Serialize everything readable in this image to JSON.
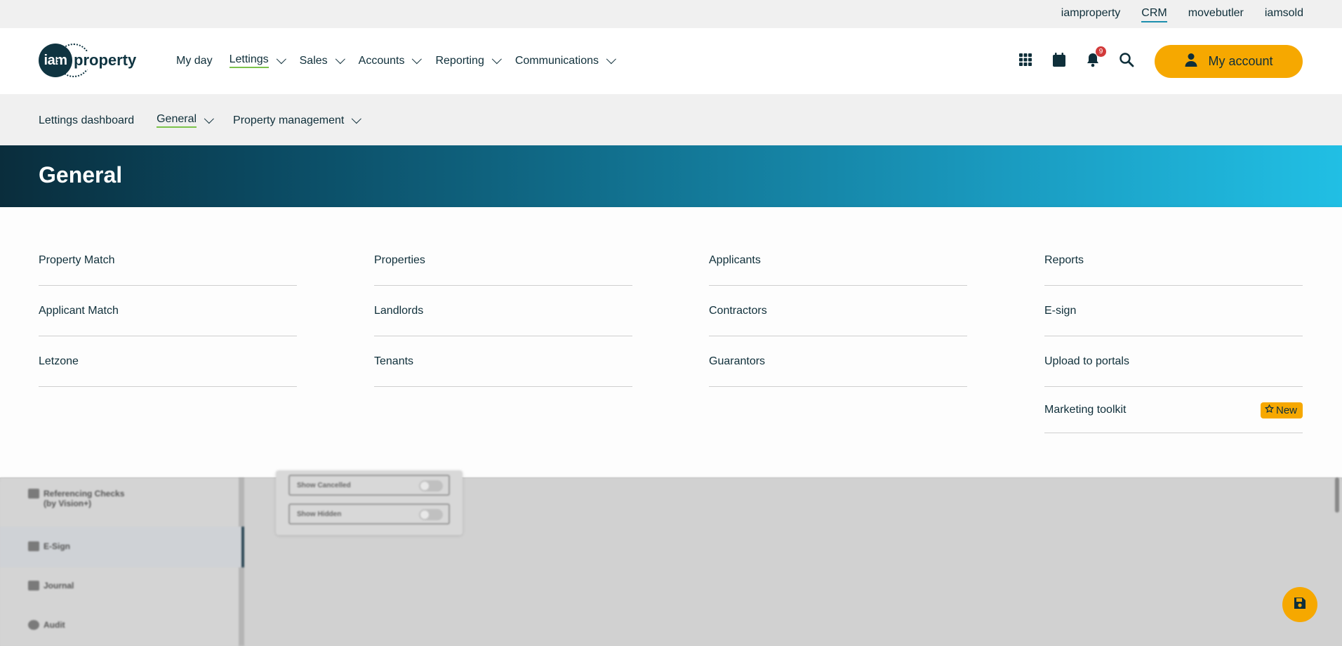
{
  "topbar": {
    "links": [
      "iamproperty",
      "CRM",
      "movebutler",
      "iamsold"
    ],
    "active": "CRM"
  },
  "header": {
    "logo_text": "iam",
    "logo_word": "property",
    "nav": [
      {
        "label": "My day",
        "has_dropdown": false
      },
      {
        "label": "Lettings",
        "has_dropdown": true,
        "active": true
      },
      {
        "label": "Sales",
        "has_dropdown": true
      },
      {
        "label": "Accounts",
        "has_dropdown": true
      },
      {
        "label": "Reporting",
        "has_dropdown": true
      },
      {
        "label": "Communications",
        "has_dropdown": true
      }
    ],
    "notifications_count": "9",
    "account_label": "My account",
    "icons": [
      "apps-grid-icon",
      "calendar-icon",
      "bell-icon",
      "search-icon",
      "user-icon"
    ]
  },
  "subnav": {
    "items": [
      {
        "label": "Lettings dashboard",
        "has_dropdown": false
      },
      {
        "label": "General",
        "has_dropdown": true,
        "active": true
      },
      {
        "label": "Property management",
        "has_dropdown": true
      }
    ]
  },
  "banner": {
    "title": "General"
  },
  "mega": {
    "columns": [
      [
        "Property Match",
        "Applicant Match",
        "Letzone"
      ],
      [
        "Properties",
        "Landlords",
        "Tenants"
      ],
      [
        "Applicants",
        "Contractors",
        "Guarantors"
      ],
      [
        "Reports",
        "E-sign",
        "Upload to portals",
        "Marketing toolkit"
      ]
    ],
    "new_badge": "New"
  },
  "background": {
    "sidebar": [
      "Referencing Checks (by Vision+)",
      "E-Sign",
      "Journal",
      "Audit"
    ],
    "toggles": [
      "Show Cancelled",
      "Show Hidden"
    ]
  },
  "colors": {
    "accent": "#f6a800",
    "brand_dark": "#0f3441",
    "active_underline": "#7cc24b",
    "badge": "#d23a3a"
  }
}
